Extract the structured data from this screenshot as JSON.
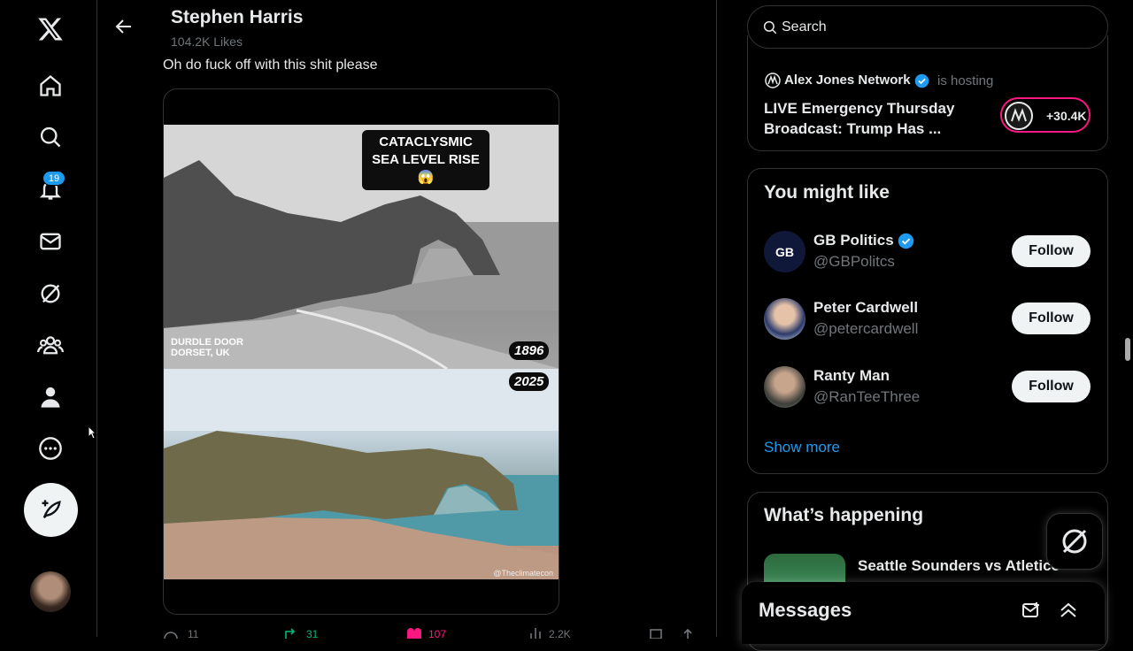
{
  "header": {
    "name": "Stephen Harris",
    "likes": "104.2K Likes"
  },
  "nav": {
    "notifications_badge": "19"
  },
  "tweet": {
    "text": "Oh do fuck off with this shit please",
    "media": {
      "caption": "CATACLYSMIC SEA LEVEL RISE 😱",
      "place": "DURDLE DOOR DORSET, UK",
      "year_old": "1896",
      "year_new": "2025",
      "watermark": "@Theclimatecon"
    },
    "actions": {
      "replies": "11",
      "reposts": "31",
      "likes": "107",
      "views": "2.2K"
    }
  },
  "search": {
    "placeholder": "Search"
  },
  "live": {
    "host": "Alex Jones Network",
    "host_suffix": "is hosting",
    "title": "LIVE Emergency Thursday Broadcast: Trump Has ...",
    "listeners": "+30.4K"
  },
  "you_might_like": {
    "title": "You might like",
    "accounts": [
      {
        "name": "GB Politics",
        "handle": "@GBPolitcs",
        "verified": true,
        "follow": "Follow"
      },
      {
        "name": "Peter Cardwell",
        "handle": "@petercardwell",
        "verified": false,
        "follow": "Follow"
      },
      {
        "name": "Ranty Man",
        "handle": "@RanTeeThree",
        "verified": false,
        "follow": "Follow"
      }
    ],
    "show_more": "Show more"
  },
  "whats_happening": {
    "title": "What’s happening",
    "first_item": "Seattle Sounders vs Atletico"
  },
  "messages": {
    "title": "Messages"
  },
  "colors": {
    "accent": "#1d9bf0",
    "live_ring": "#f91880",
    "background": "#000000"
  }
}
